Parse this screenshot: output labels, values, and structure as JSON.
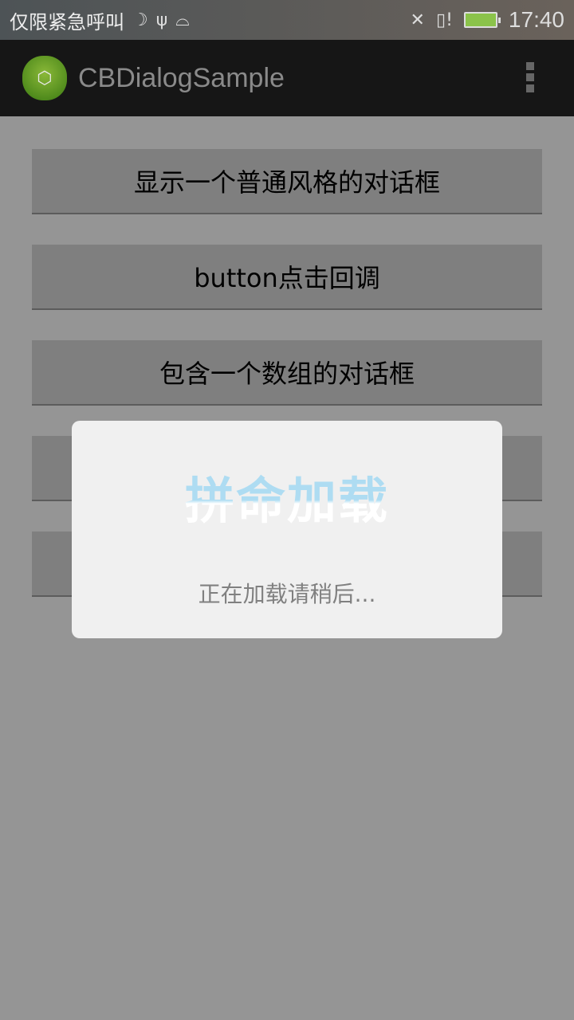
{
  "status_bar": {
    "carrier": "仅限紧急呼叫",
    "time": "17:40",
    "icons": [
      "moon-icon",
      "usb-icon",
      "android-debug-icon",
      "mute-icon",
      "sim-alert-icon",
      "battery-charging-icon"
    ]
  },
  "action_bar": {
    "title": "CBDialogSample",
    "icon": "android-app-icon",
    "menu": "overflow-menu-icon"
  },
  "buttons": [
    {
      "label": "显示一个普通风格的对话框"
    },
    {
      "label": "button点击回调"
    },
    {
      "label": "包含一个数组的对话框"
    },
    {
      "label": ""
    },
    {
      "label": ""
    }
  ],
  "dialog": {
    "loading_text": "拼命加载",
    "message": "正在加载请稍后...",
    "fill_color": "#aedcf2"
  }
}
